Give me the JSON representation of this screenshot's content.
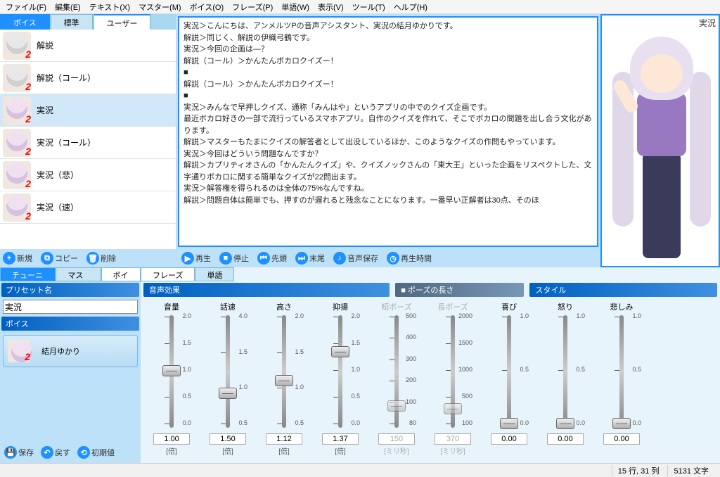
{
  "menu": [
    "ファイル(F)",
    "編集(E)",
    "テキスト(X)",
    "マスター(M)",
    "ボイス(O)",
    "フレーズ(P)",
    "単語(W)",
    "表示(V)",
    "ツール(T)",
    "ヘルプ(H)"
  ],
  "voice_tabs": {
    "t0": "ボイス",
    "t1": "標準",
    "t2": "ユーザー"
  },
  "voices": [
    {
      "label": "解説",
      "avatar": "grey"
    },
    {
      "label": "解説（コール）",
      "avatar": "grey"
    },
    {
      "label": "実況",
      "avatar": "purple",
      "selected": true
    },
    {
      "label": "実況（コール）",
      "avatar": "purple"
    },
    {
      "label": "実況（悲）",
      "avatar": "purple"
    },
    {
      "label": "実況（速）",
      "avatar": "purple"
    }
  ],
  "left_btns": {
    "new": "新規",
    "copy": "コピー",
    "delete": "削除"
  },
  "script_lines": [
    "実況＞こんにちは、アンメルツPの音声アシスタント、実況の結月ゆかりです。",
    "解説＞同じく、解説の伊織弓鶴です。",
    "実況＞今回の企画は―？",
    "解説（コール）＞かんたんボカロクイズー！",
    "■",
    "解説（コール）＞かんたんボカロクイズー！",
    "■",
    "実況＞みんなで早押しクイズ、通称「みんはや」というアプリの中でのクイズ企画です。",
    "最近ボカロ好きの一部で流行っているスマホアプリ。自作のクイズを作れて、そこでボカロの問題を出し合う文化があります。",
    "解説＞マスターもたまにクイズの解答者として出没しているほか、このようなクイズの作問もやっています。",
    "実況＞今回はどういう問題なんですか？",
    "解説＞カプリティオさんの「かんたんクイズ」や、クイズノックさんの「東大王」といった企画をリスペクトした、文字通りボカロに関する簡単なクイズが22問出ます。",
    "実況＞解答権を得られるのは全体の75%なんですね。",
    "解説＞問題自体は簡単でも、押すのが遅れると残念なことになります。一番早い正解者は30点、そのほ"
  ],
  "play_btns": {
    "play": "再生",
    "stop": "停止",
    "head": "先頭",
    "tail": "末尾",
    "save": "音声保存",
    "time": "再生時間"
  },
  "char_label": "実況",
  "tuning_tabs": {
    "t0": "チューニング",
    "t1": "マスター",
    "t2": "ボイス"
  },
  "param_tabs": {
    "t0": "フレーズ",
    "t1": "単語"
  },
  "preset_header": "プリセット名",
  "preset_value": "実況",
  "voice_header": "ボイス",
  "voice_sel": "結月ゆかり",
  "bl_btns": {
    "save": "保存",
    "undo": "戻す",
    "reset": "初期値"
  },
  "sections": {
    "s0": "音声効果",
    "s1": "ポーズの長さ",
    "s2": "スタイル"
  },
  "sliders": [
    {
      "label": "音量",
      "val": "1.00",
      "unit": "[倍]",
      "min": 0.0,
      "max": 2.0,
      "pos": 0.5,
      "ticks": [
        "2.0",
        "1.5",
        "1.0",
        "0.5",
        "0.0"
      ]
    },
    {
      "label": "話速",
      "val": "1.50",
      "unit": "[倍]",
      "min": 0.5,
      "max": 4.0,
      "pos": 0.71,
      "ticks": [
        "4.0",
        "1.5",
        "1.0",
        "0.5"
      ]
    },
    {
      "label": "高さ",
      "val": "1.12",
      "unit": "[倍]",
      "min": 0.5,
      "max": 2.0,
      "pos": 0.59,
      "ticks": [
        "2.0",
        "1.5",
        "1.0",
        "0.5"
      ]
    },
    {
      "label": "抑揚",
      "val": "1.37",
      "unit": "[倍]",
      "min": 0.0,
      "max": 2.0,
      "pos": 0.32,
      "ticks": [
        "2.0",
        "1.5",
        "1.0",
        "0.5",
        "0.0"
      ]
    },
    {
      "label": "短ポーズ",
      "val": "150",
      "unit": "[ミリ秒]",
      "min": 80,
      "max": 500,
      "pos": 0.83,
      "ticks": [
        "500",
        "400",
        "300",
        "200",
        "100",
        "80"
      ],
      "dim": true
    },
    {
      "label": "長ポーズ",
      "val": "370",
      "unit": "[ミリ秒]",
      "min": 100,
      "max": 2000,
      "pos": 0.86,
      "ticks": [
        "2000",
        "1500",
        "1000",
        "500",
        "100"
      ],
      "dim": true
    },
    {
      "label": "喜び",
      "val": "0.00",
      "unit": "",
      "min": 0.0,
      "max": 1.0,
      "pos": 1.0,
      "ticks": [
        "1.0",
        "0.5",
        "0.0"
      ]
    },
    {
      "label": "怒り",
      "val": "0.00",
      "unit": "",
      "min": 0.0,
      "max": 1.0,
      "pos": 1.0,
      "ticks": [
        "1.0",
        "0.5",
        "0.0"
      ]
    },
    {
      "label": "悲しみ",
      "val": "0.00",
      "unit": "",
      "min": 0.0,
      "max": 1.0,
      "pos": 1.0,
      "ticks": [
        "1.0",
        "0.5",
        "0.0"
      ]
    }
  ],
  "status": {
    "pos": "15 行, 31 列",
    "chars": "5131 文字"
  }
}
